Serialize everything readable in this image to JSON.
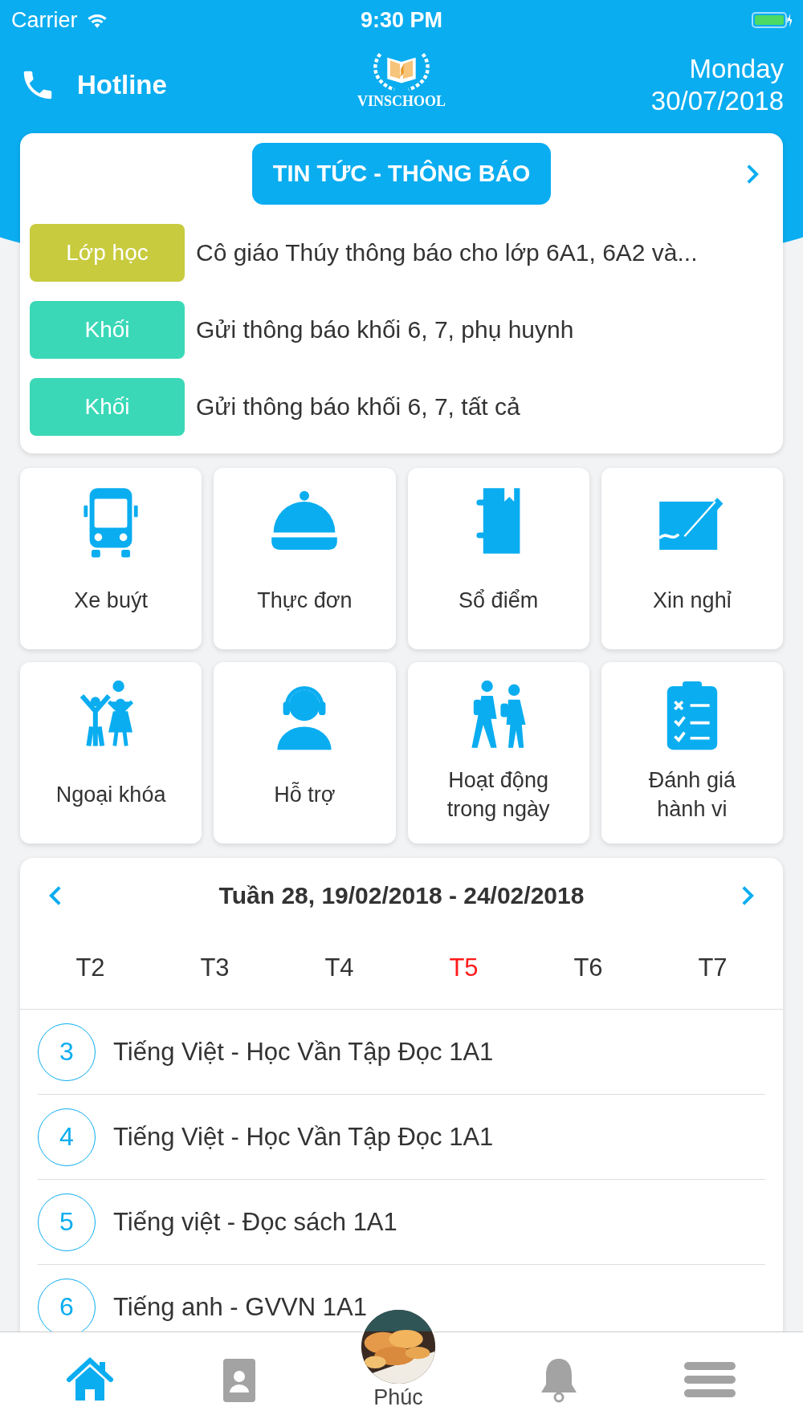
{
  "status_bar": {
    "carrier": "Carrier",
    "time": "9:30 PM"
  },
  "header": {
    "hotline": "Hotline",
    "logo": "VINSCHOOL",
    "weekday": "Monday",
    "date": "30/07/2018"
  },
  "news": {
    "title": "TIN TỨC - THÔNG BÁO",
    "items": [
      {
        "tag": "Lớp học",
        "color": "#c8cb3e",
        "text": "Cô giáo Thúy thông báo cho lớp 6A1, 6A2 và..."
      },
      {
        "tag": "Khối",
        "color": "#3ad8b7",
        "text": "Gửi thông báo khối 6, 7, phụ huynh"
      },
      {
        "tag": "Khối",
        "color": "#3ad8b7",
        "text": "Gửi thông báo khối 6, 7, tất cả"
      }
    ]
  },
  "features": [
    "Xe buýt",
    "Thực đơn",
    "Sổ điểm",
    "Xin nghỉ",
    "Ngoại khóa",
    "Hỗ trợ",
    "Hoạt động trong ngày",
    "Đánh giá hành vi"
  ],
  "schedule": {
    "week": "Tuần 28, 19/02/2018 - 24/02/2018",
    "days": [
      {
        "label": "T2",
        "selected": false
      },
      {
        "label": "T3",
        "selected": false
      },
      {
        "label": "T4",
        "selected": false
      },
      {
        "label": "T5",
        "selected": true
      },
      {
        "label": "T6",
        "selected": false
      },
      {
        "label": "T7",
        "selected": false
      }
    ],
    "lessons": [
      {
        "period": "3",
        "subject": "Tiếng Việt - Học Vần Tập Đọc 1A1"
      },
      {
        "period": "4",
        "subject": "Tiếng Việt - Học Vần Tập Đọc 1A1"
      },
      {
        "period": "5",
        "subject": "Tiếng việt - Đọc sách 1A1"
      },
      {
        "period": "6",
        "subject": "Tiếng anh - GVVN 1A1"
      }
    ]
  },
  "tab_bar": {
    "items": [
      {
        "kind": "home",
        "selected": true
      },
      {
        "kind": "contacts",
        "selected": false
      },
      {
        "kind": "profile",
        "label": "Phúc",
        "selected": false
      },
      {
        "kind": "notifications",
        "selected": false
      },
      {
        "kind": "menu",
        "selected": false
      }
    ]
  }
}
